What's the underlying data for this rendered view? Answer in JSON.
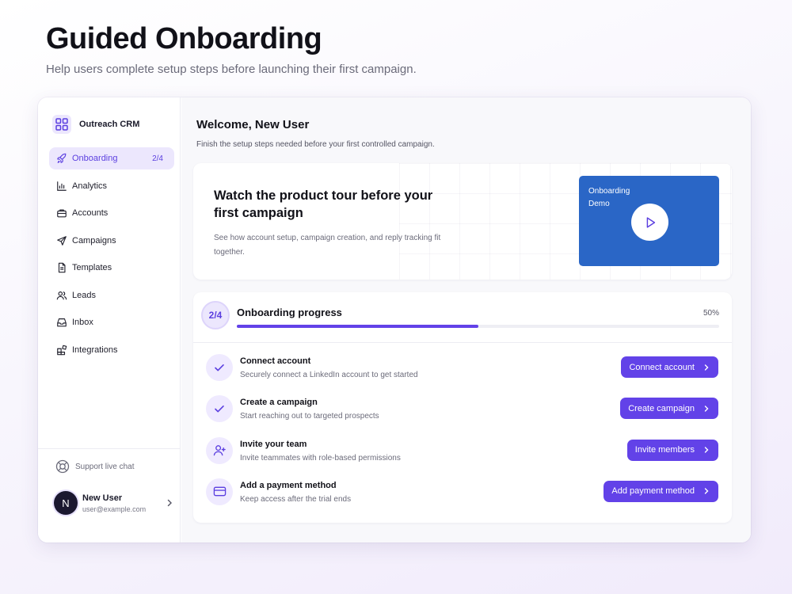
{
  "hero": {
    "title": "Guided Onboarding",
    "subtitle": "Help users complete setup steps before launching their first campaign."
  },
  "colors": {
    "accent": "#6242e8",
    "accent_soft": "#ece7fd",
    "video_bg": "#2a66c6"
  },
  "sidebar": {
    "brand": {
      "name": "Outreach CRM",
      "icon": "grid-icon"
    },
    "items": [
      {
        "label": "Onboarding",
        "icon": "rocket-icon",
        "badge": "2/4",
        "active": true
      },
      {
        "label": "Analytics",
        "icon": "bar-chart-icon"
      },
      {
        "label": "Accounts",
        "icon": "briefcase-icon"
      },
      {
        "label": "Campaigns",
        "icon": "send-icon"
      },
      {
        "label": "Templates",
        "icon": "document-icon"
      },
      {
        "label": "Leads",
        "icon": "users-icon"
      },
      {
        "label": "Inbox",
        "icon": "inbox-icon"
      },
      {
        "label": "Integrations",
        "icon": "puzzle-icon"
      }
    ],
    "support": {
      "label": "Support live chat",
      "icon": "lifebuoy-icon"
    },
    "user": {
      "initial": "N",
      "name": "New User",
      "email": "user@example.com"
    }
  },
  "main": {
    "welcome_title": "Welcome, New User",
    "welcome_subtitle": "Finish the setup steps needed before your first controlled campaign.",
    "tour": {
      "title": "Watch the product tour before your first campaign",
      "description": "See how account setup, campaign creation, and reply tracking fit together.",
      "video_label": "Onboarding Demo"
    },
    "progress": {
      "badge": "2/4",
      "title": "Onboarding progress",
      "percent_label": "50%",
      "fraction": 0.5
    },
    "steps": [
      {
        "title": "Connect account",
        "description": "Securely connect a LinkedIn account to get started",
        "button": "Connect account",
        "icon": "check-icon",
        "done": true
      },
      {
        "title": "Create a campaign",
        "description": "Start reaching out to targeted prospects",
        "button": "Create campaign",
        "icon": "check-icon",
        "done": true
      },
      {
        "title": "Invite your team",
        "description": "Invite teammates with role-based permissions",
        "button": "Invite members",
        "icon": "user-plus-icon",
        "done": false
      },
      {
        "title": "Add a payment method",
        "description": "Keep access after the trial ends",
        "button": "Add payment method",
        "icon": "credit-card-icon",
        "done": false
      }
    ]
  }
}
